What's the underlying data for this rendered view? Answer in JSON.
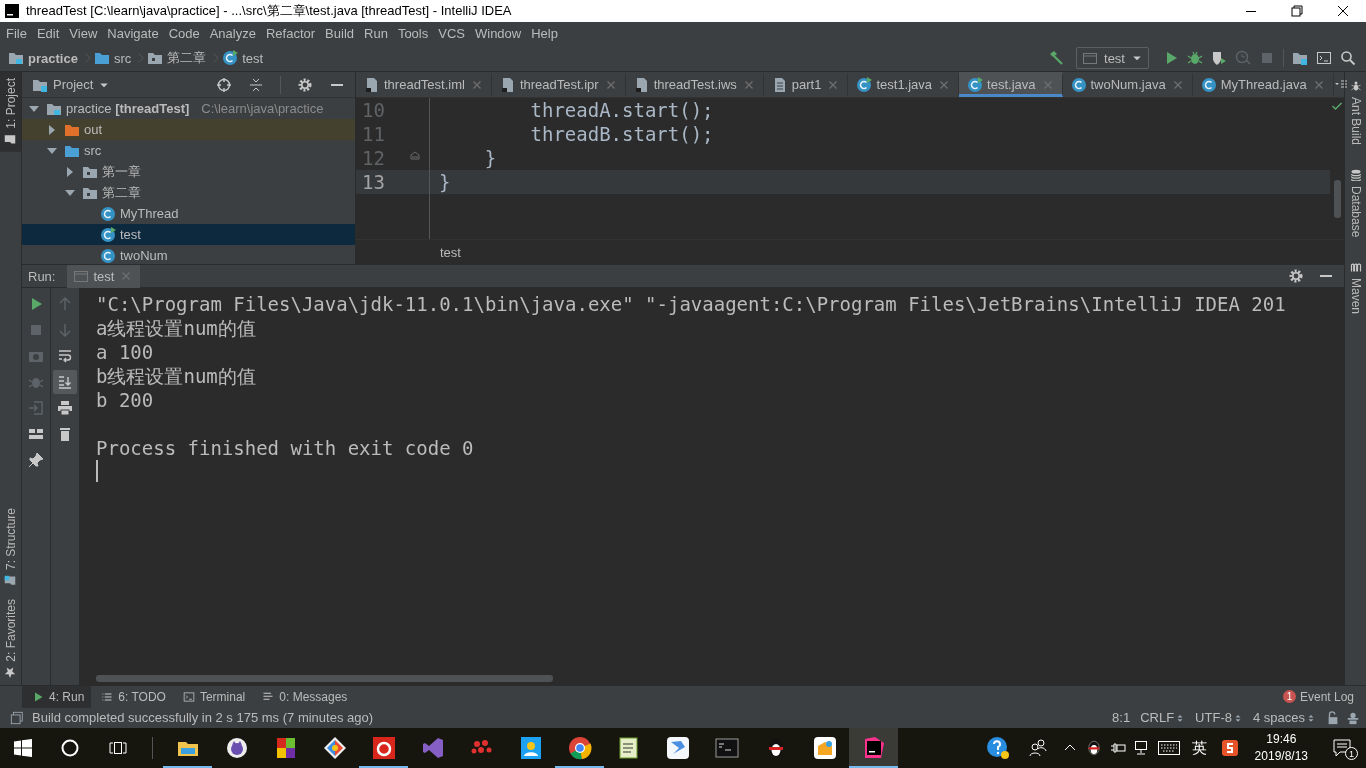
{
  "window": {
    "title": "threadTest [C:\\learn\\java\\practice] - ...\\src\\第二章\\test.java [threadTest] - IntelliJ IDEA"
  },
  "menu": [
    "File",
    "Edit",
    "View",
    "Navigate",
    "Code",
    "Analyze",
    "Refactor",
    "Build",
    "Run",
    "Tools",
    "VCS",
    "Window",
    "Help"
  ],
  "breadcrumbs": [
    {
      "label": "practice",
      "kind": "module"
    },
    {
      "label": "src",
      "kind": "source-folder"
    },
    {
      "label": "第二章",
      "kind": "package"
    },
    {
      "label": "test",
      "kind": "main-class"
    }
  ],
  "run_config": {
    "label": "test"
  },
  "toolbar": [
    {
      "kind": "run",
      "disabled": false
    },
    {
      "kind": "debug",
      "disabled": false
    },
    {
      "kind": "coverage",
      "disabled": false
    },
    {
      "kind": "profile",
      "disabled": true
    },
    {
      "kind": "stop",
      "disabled": true
    },
    {
      "kind": "structure",
      "disabled": false
    },
    {
      "kind": "terminal",
      "disabled": false
    },
    {
      "kind": "search",
      "disabled": false
    }
  ],
  "left_stripe": [
    {
      "label": "1: Project",
      "kind": "project",
      "selected": true
    },
    {
      "label": "7: Structure",
      "kind": "structure",
      "selected": false
    },
    {
      "label": "2: Favorites",
      "kind": "favorites",
      "selected": false
    }
  ],
  "right_stripe": [
    {
      "label": "Ant Build",
      "kind": "ant"
    },
    {
      "label": "Database",
      "kind": "database"
    },
    {
      "label": "Maven",
      "kind": "maven"
    }
  ],
  "project_panel": {
    "title": "Project",
    "tree": [
      {
        "label": "practice **[threadTest]**",
        "path": "C:\\learn\\java\\practice",
        "kind": "module",
        "expanded": true,
        "selected": false,
        "children": [
          {
            "label": "out",
            "kind": "excluded-folder",
            "expanded": false,
            "selected": false
          },
          {
            "label": "src",
            "kind": "source-folder",
            "expanded": true,
            "selected": false,
            "children": [
              {
                "label": "第一章",
                "kind": "package",
                "expanded": false,
                "selected": false
              },
              {
                "label": "第二章",
                "kind": "package",
                "expanded": true,
                "selected": false,
                "children": [
                  {
                    "label": "MyThread",
                    "kind": "class",
                    "selected": false
                  },
                  {
                    "label": "test",
                    "kind": "main-class",
                    "selected": true
                  },
                  {
                    "label": "twoNum",
                    "kind": "class",
                    "selected": false
                  }
                ]
              }
            ]
          }
        ]
      }
    ]
  },
  "editor": {
    "tabs": [
      {
        "label": "threadTest.iml",
        "kind": "file",
        "selected": false
      },
      {
        "label": "threadTest.ipr",
        "kind": "file",
        "selected": false
      },
      {
        "label": "threadTest.iws",
        "kind": "file",
        "selected": false
      },
      {
        "label": "part1",
        "kind": "text",
        "selected": false
      },
      {
        "label": "test1.java",
        "kind": "main-class",
        "selected": false
      },
      {
        "label": "test.java",
        "kind": "main-class",
        "selected": true
      },
      {
        "label": "twoNum.java",
        "kind": "class",
        "selected": false
      },
      {
        "label": "MyThread.java",
        "kind": "class",
        "selected": false
      }
    ],
    "lines": [
      {
        "number": "10",
        "code": "        threadA.start();",
        "current": false,
        "fold_marker": false
      },
      {
        "number": "11",
        "code": "        threadB.start();",
        "current": false,
        "fold_marker": false
      },
      {
        "number": "12",
        "code": "    }",
        "current": false,
        "fold_marker": true
      },
      {
        "number": "13",
        "code": "}",
        "current": true,
        "fold_marker": false
      }
    ],
    "breadcrumb": "test"
  },
  "run_panel": {
    "label": "Run:",
    "tab": "test",
    "output": [
      "\"C:\\Program Files\\Java\\jdk-11.0.1\\bin\\java.exe\" \"-javaagent:C:\\Program Files\\JetBrains\\IntelliJ IDEA 201",
      "a线程设置num的值",
      "a 100",
      "b线程设置num的值",
      "b 200"
    ],
    "exit_message": "Process finished with exit code 0",
    "tools_left": [
      {
        "kind": "rerun",
        "disabled": false
      },
      {
        "kind": "stop",
        "disabled": true
      },
      {
        "kind": "camera",
        "disabled": true
      },
      {
        "kind": "bug",
        "disabled": true
      },
      {
        "kind": "exit",
        "disabled": true
      },
      {
        "kind": "layout",
        "disabled": false
      },
      {
        "kind": "pin",
        "disabled": false
      }
    ],
    "tools_right": [
      {
        "kind": "up",
        "disabled": true,
        "on": false
      },
      {
        "kind": "down",
        "disabled": true,
        "on": false
      },
      {
        "kind": "wrap",
        "disabled": false,
        "on": false
      },
      {
        "kind": "scroll-end",
        "disabled": false,
        "on": true
      },
      {
        "kind": "print",
        "disabled": false,
        "on": false
      },
      {
        "kind": "trash",
        "disabled": false,
        "on": false
      }
    ]
  },
  "tool_tabs": [
    {
      "label": "4: Run",
      "kind": "run",
      "selected": true
    },
    {
      "label": "6: TODO",
      "kind": "todo",
      "selected": false
    },
    {
      "label": "Terminal",
      "kind": "terminal",
      "selected": false
    },
    {
      "label": "0: Messages",
      "kind": "messages",
      "selected": false
    }
  ],
  "event_log": {
    "label": "Event Log",
    "badge": "1"
  },
  "status": {
    "message": "Build completed successfully in 2 s 175 ms (7 minutes ago)",
    "items": [
      {
        "label": "8:1",
        "kind": "plain"
      },
      {
        "label": "CRLF",
        "kind": "select"
      },
      {
        "label": "UTF-8",
        "kind": "select"
      },
      {
        "label": "4 spaces",
        "kind": "select"
      }
    ]
  },
  "taskbar": {
    "apps": [
      {
        "kind": "files",
        "running": true,
        "selected": false
      },
      {
        "kind": "cat",
        "running": false,
        "selected": false
      },
      {
        "kind": "blocks",
        "running": false,
        "selected": false
      },
      {
        "kind": "diamond",
        "running": false,
        "selected": false
      },
      {
        "kind": "music",
        "running": true,
        "selected": false
      },
      {
        "kind": "studio",
        "running": false,
        "selected": false
      },
      {
        "kind": "dots",
        "running": false,
        "selected": false
      },
      {
        "kind": "contacts",
        "running": false,
        "selected": false
      },
      {
        "kind": "browser",
        "running": true,
        "selected": false
      },
      {
        "kind": "notepad",
        "running": false,
        "selected": false
      },
      {
        "kind": "bird",
        "running": false,
        "selected": false
      },
      {
        "kind": "console",
        "running": false,
        "selected": false
      },
      {
        "kind": "penguin",
        "running": false,
        "selected": false
      },
      {
        "kind": "box",
        "running": false,
        "selected": false
      },
      {
        "kind": "ide",
        "running": true,
        "selected": true
      }
    ],
    "language": "英",
    "time": "19:46",
    "date": "2019/8/13",
    "notifications": "1"
  }
}
